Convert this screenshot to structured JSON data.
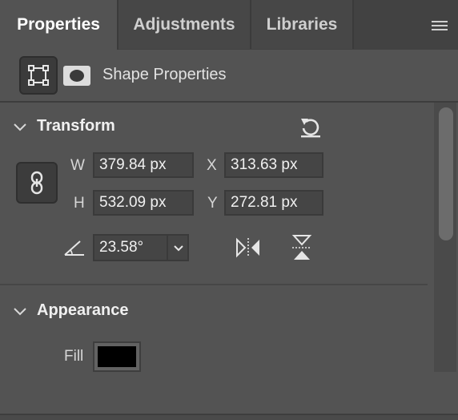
{
  "tabs": [
    {
      "label": "Properties",
      "active": true
    },
    {
      "label": "Adjustments",
      "active": false
    },
    {
      "label": "Libraries",
      "active": false
    }
  ],
  "header": {
    "title": "Shape Properties",
    "icons": [
      "shape-bounding-box-icon",
      "mask-icon"
    ]
  },
  "transform": {
    "title": "Transform",
    "w_label": "W",
    "w_value": "379.84 px",
    "x_label": "X",
    "x_value": "313.63 px",
    "h_label": "H",
    "h_value": "532.09 px",
    "y_label": "Y",
    "y_value": "272.81 px",
    "angle_value": "23.58°",
    "icons": [
      "reset-transform-icon",
      "link-icon",
      "angle-icon",
      "flip-horizontal-icon",
      "flip-vertical-icon"
    ]
  },
  "appearance": {
    "title": "Appearance",
    "fill_label": "Fill",
    "fill_color": "#000000"
  },
  "colors": {
    "panel_bg": "#535353",
    "tabbar_bg": "#424242",
    "field_bg": "#454545",
    "text": "#f0f0f0"
  }
}
